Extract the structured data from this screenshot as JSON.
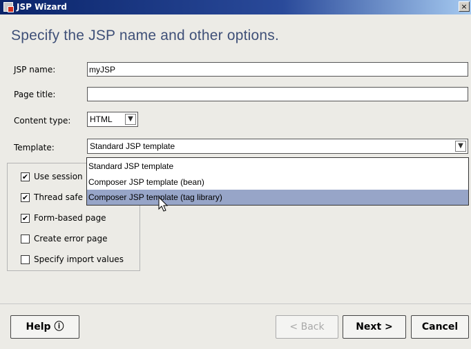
{
  "window": {
    "title": "JSP Wizard",
    "close_label": "×",
    "heading": "Specify the JSP name and other options."
  },
  "form": {
    "jsp_name_label": "JSP name:",
    "jsp_name_value": "myJSP",
    "page_title_label": "Page title:",
    "page_title_value": "",
    "content_type_label": "Content type:",
    "content_type_value": "HTML",
    "template_label": "Template:",
    "template_value": "Standard JSP template"
  },
  "template_options": [
    "Standard JSP template",
    "Composer JSP template (bean)",
    "Composer JSP template (tag library)"
  ],
  "template_highlighted_index": 2,
  "checkboxes": [
    {
      "label": "Use session",
      "checked": true
    },
    {
      "label": "Thread safe",
      "checked": true
    },
    {
      "label": "Form-based page",
      "checked": true
    },
    {
      "label": "Create error page",
      "checked": false
    },
    {
      "label": "Specify import values",
      "checked": false
    }
  ],
  "buttons": {
    "help": "Help ⓘ",
    "back": "< Back",
    "next": "Next >",
    "cancel": "Cancel"
  },
  "icons": {
    "dropdown": "chevron-down-icon",
    "app": "jsp-wizard-app-icon",
    "cursor": "mouse-pointer-icon"
  }
}
